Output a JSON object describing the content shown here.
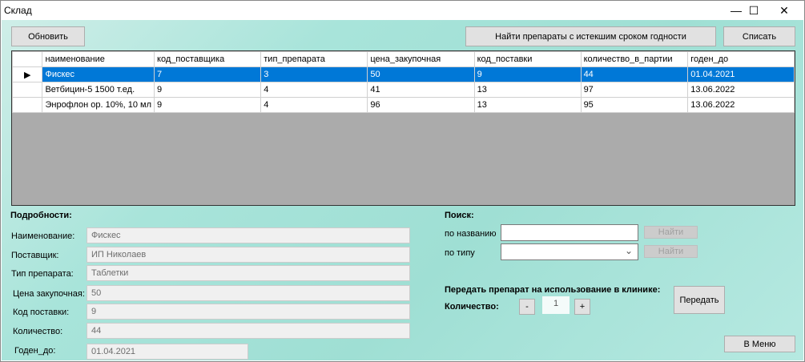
{
  "window": {
    "title": "Склад",
    "minimize": "—",
    "maximize": "☐",
    "close": "✕"
  },
  "toolbar": {
    "refresh": "Обновить",
    "find_expired": "Найти препараты с истекшим сроком годности",
    "write_off": "Списать"
  },
  "table": {
    "columns": [
      "наименование",
      "код_поставщика",
      "тип_препарата",
      "цена_закупочная",
      "код_поставки",
      "количество_в_партии",
      "годен_до"
    ],
    "rows": [
      [
        "Фискес",
        "7",
        "3",
        "50",
        "9",
        "44",
        "01.04.2021"
      ],
      [
        "Ветбицин-5 1500 т.ед.",
        "9",
        "4",
        "41",
        "13",
        "97",
        "13.06.2022"
      ],
      [
        "Энрофлон ор. 10%, 10 мл",
        "9",
        "4",
        "96",
        "13",
        "95",
        "13.06.2022"
      ]
    ],
    "row_indicator": "▶"
  },
  "details": {
    "heading": "Подробности:",
    "fields": [
      {
        "label": "Наименование:",
        "value": "Фискес"
      },
      {
        "label": "Поставщик:",
        "value": "ИП Николаев"
      },
      {
        "label": "Тип препарата:",
        "value": "Таблетки"
      },
      {
        "label": "Цена закупочная:",
        "value": "50"
      },
      {
        "label": "Код поставки:",
        "value": "9"
      },
      {
        "label": "Количество:",
        "value": "44"
      },
      {
        "label": "Годен_до:",
        "value": "01.04.2021"
      }
    ]
  },
  "search": {
    "heading": "Поиск:",
    "by_name": "по названию",
    "by_type": "по типу",
    "find": "Найти",
    "name_value": "",
    "type_value": "",
    "chevron": "⌄"
  },
  "transfer": {
    "heading": "Передать препарат на использование в клинике:",
    "qty_label": "Количество:",
    "minus": "-",
    "qty": "1",
    "plus": "+",
    "button": "Передать"
  },
  "menu": "В Меню"
}
